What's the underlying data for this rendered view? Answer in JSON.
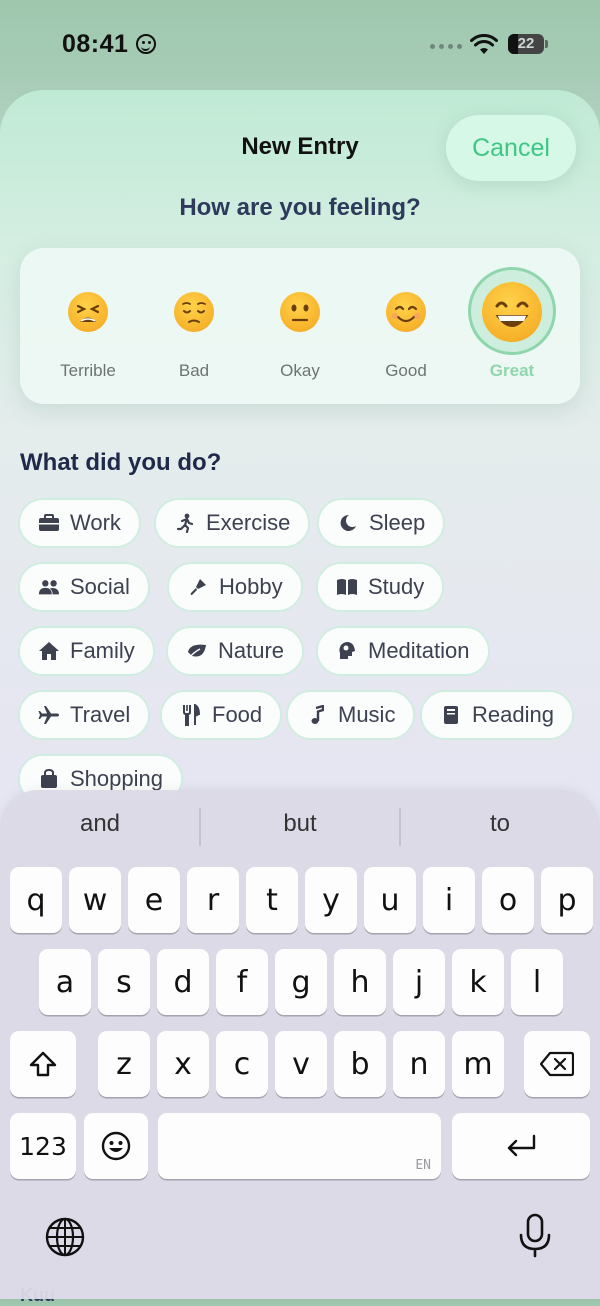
{
  "status": {
    "time": "08:41",
    "battery": "22"
  },
  "header": {
    "title": "New Entry",
    "cancel_label": "Cancel"
  },
  "mood": {
    "question": "How are you feeling?",
    "options": [
      "Terrible",
      "Bad",
      "Okay",
      "Good",
      "Great"
    ],
    "selected": "Great"
  },
  "activities": {
    "title": "What did you do?",
    "items": [
      {
        "label": "Work",
        "icon": "briefcase-icon"
      },
      {
        "label": "Exercise",
        "icon": "running-icon"
      },
      {
        "label": "Sleep",
        "icon": "moon-icon"
      },
      {
        "label": "Social",
        "icon": "people-icon"
      },
      {
        "label": "Hobby",
        "icon": "hobby-icon"
      },
      {
        "label": "Study",
        "icon": "book-icon"
      },
      {
        "label": "Family",
        "icon": "house-icon"
      },
      {
        "label": "Nature",
        "icon": "leaf-icon"
      },
      {
        "label": "Meditation",
        "icon": "brain-icon"
      },
      {
        "label": "Travel",
        "icon": "plane-icon"
      },
      {
        "label": "Food",
        "icon": "fork-knife-icon"
      },
      {
        "label": "Music",
        "icon": "music-note-icon"
      },
      {
        "label": "Reading",
        "icon": "book-closed-icon"
      },
      {
        "label": "Shopping",
        "icon": "shopping-bag-icon"
      }
    ]
  },
  "keyboard": {
    "suggestions": [
      "and",
      "but",
      "to"
    ],
    "row1": [
      "q",
      "w",
      "e",
      "r",
      "t",
      "y",
      "u",
      "i",
      "o",
      "p"
    ],
    "row2": [
      "a",
      "s",
      "d",
      "f",
      "g",
      "h",
      "j",
      "k",
      "l"
    ],
    "row3": [
      "z",
      "x",
      "c",
      "v",
      "b",
      "n",
      "m"
    ],
    "numbers_key": "123",
    "language": "EN"
  },
  "bottom_peek": "Kuu"
}
